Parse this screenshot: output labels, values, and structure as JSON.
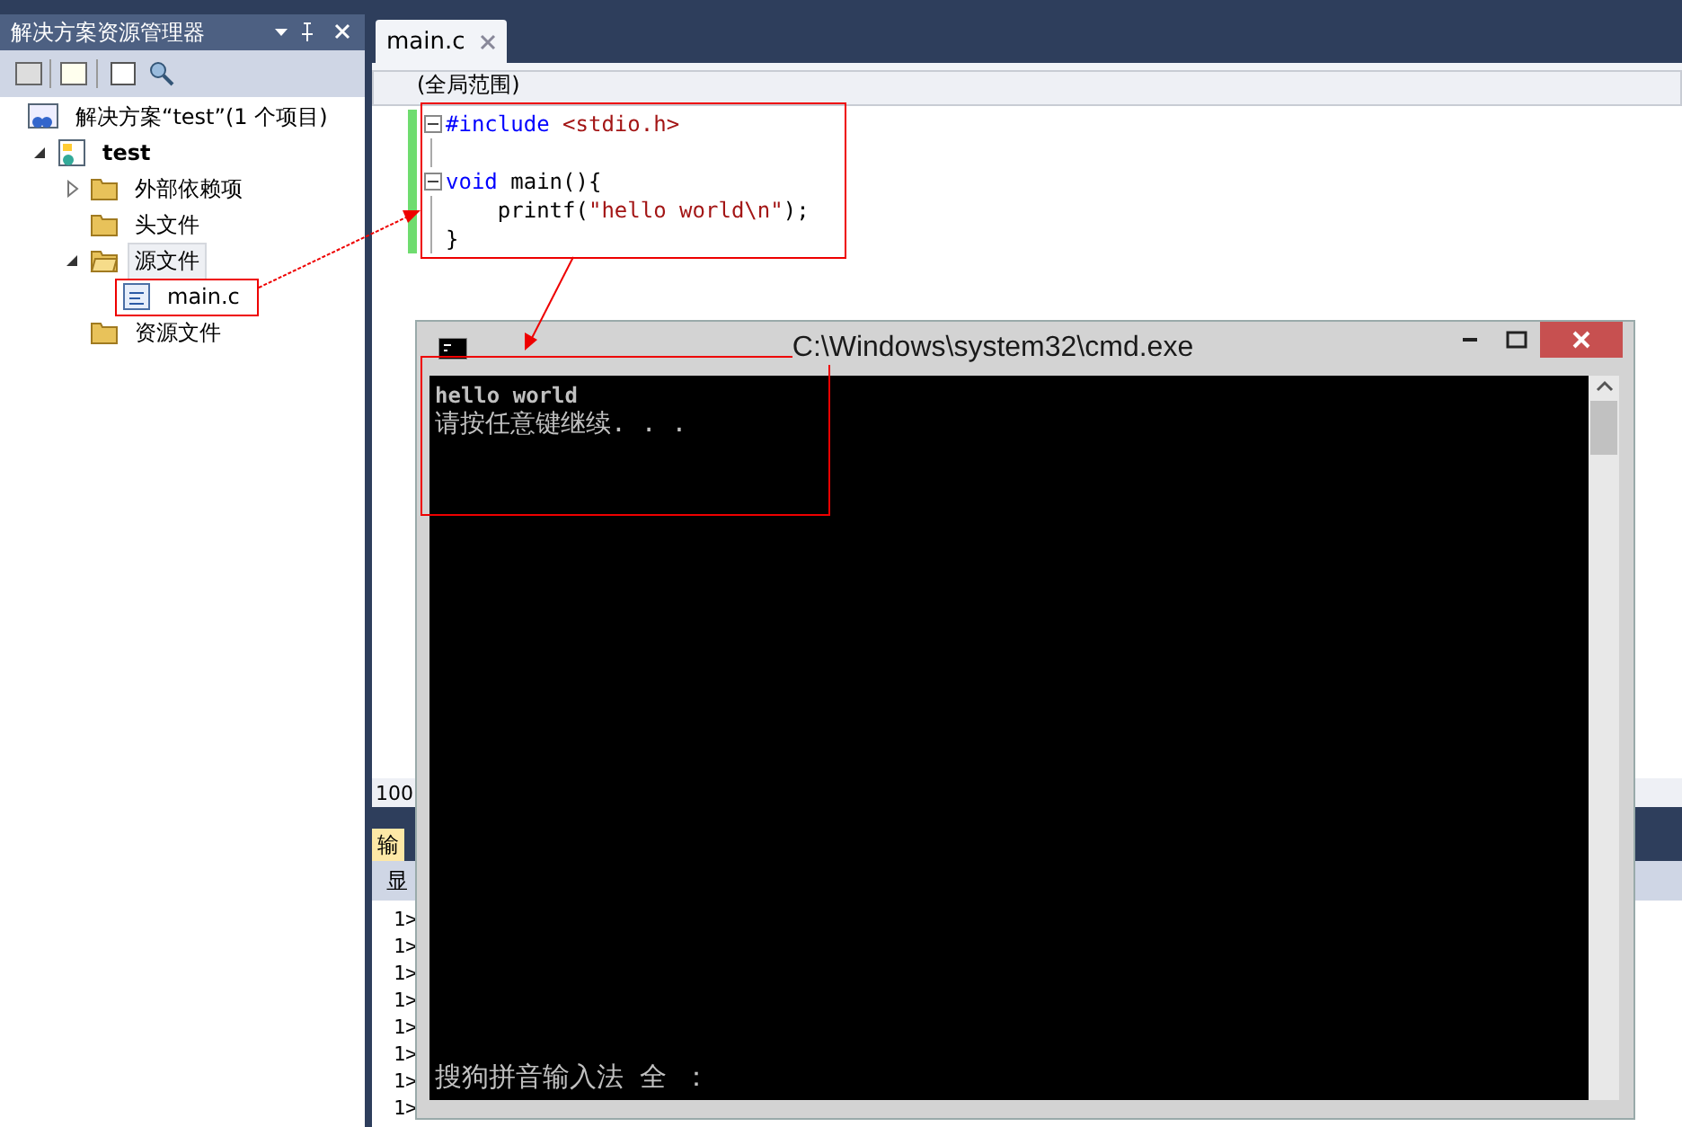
{
  "solution_explorer": {
    "title": "解决方案资源管理器",
    "tree": [
      {
        "label": "解决方案“test”(1 个项目)",
        "kind": "solution",
        "selected": false,
        "children": [
          {
            "label": "test",
            "kind": "project",
            "expanded": true,
            "selected": false,
            "children": [
              {
                "label": "外部依赖项",
                "kind": "folder",
                "expanded": false,
                "selected": false
              },
              {
                "label": "头文件",
                "kind": "folder",
                "selected": false
              },
              {
                "label": "源文件",
                "kind": "folder",
                "expanded": true,
                "selected": true,
                "children": [
                  {
                    "label": "main.c",
                    "kind": "file",
                    "selected": false
                  }
                ]
              },
              {
                "label": "资源文件",
                "kind": "folder",
                "selected": false
              }
            ]
          }
        ]
      }
    ]
  },
  "editor": {
    "tab": "main.c",
    "scope": "(全局范围)",
    "code": [
      {
        "kind": "fold_start",
        "segments": [
          {
            "t": "#include ",
            "kind": "keyword"
          },
          {
            "t": "<stdio.h>",
            "kind": "string"
          }
        ]
      },
      {
        "kind": "blank"
      },
      {
        "kind": "fold_start",
        "segments": [
          {
            "t": "void",
            "kind": "keyword"
          },
          {
            "t": " main(){",
            "kind": "plain"
          }
        ]
      },
      {
        "kind": "inner",
        "segments": [
          {
            "t": "    printf(",
            "kind": "plain"
          },
          {
            "t": "\"hello world\\n\"",
            "kind": "string"
          },
          {
            "t": ");",
            "kind": "plain"
          }
        ]
      },
      {
        "kind": "inner",
        "segments": [
          {
            "t": "}",
            "kind": "plain"
          }
        ]
      }
    ],
    "zoom": "100"
  },
  "output": {
    "tab": "输",
    "toolbar": "显",
    "lines": [
      "1>",
      "1>",
      "1>",
      "1>",
      "1>",
      "1>",
      "1>",
      "1>"
    ]
  },
  "console": {
    "title": "C:\\Windows\\system32\\cmd.exe",
    "lines": [
      "hello world",
      "请按任意键继续. . ."
    ],
    "ime_status": "搜狗拼音输入法 全 ："
  }
}
